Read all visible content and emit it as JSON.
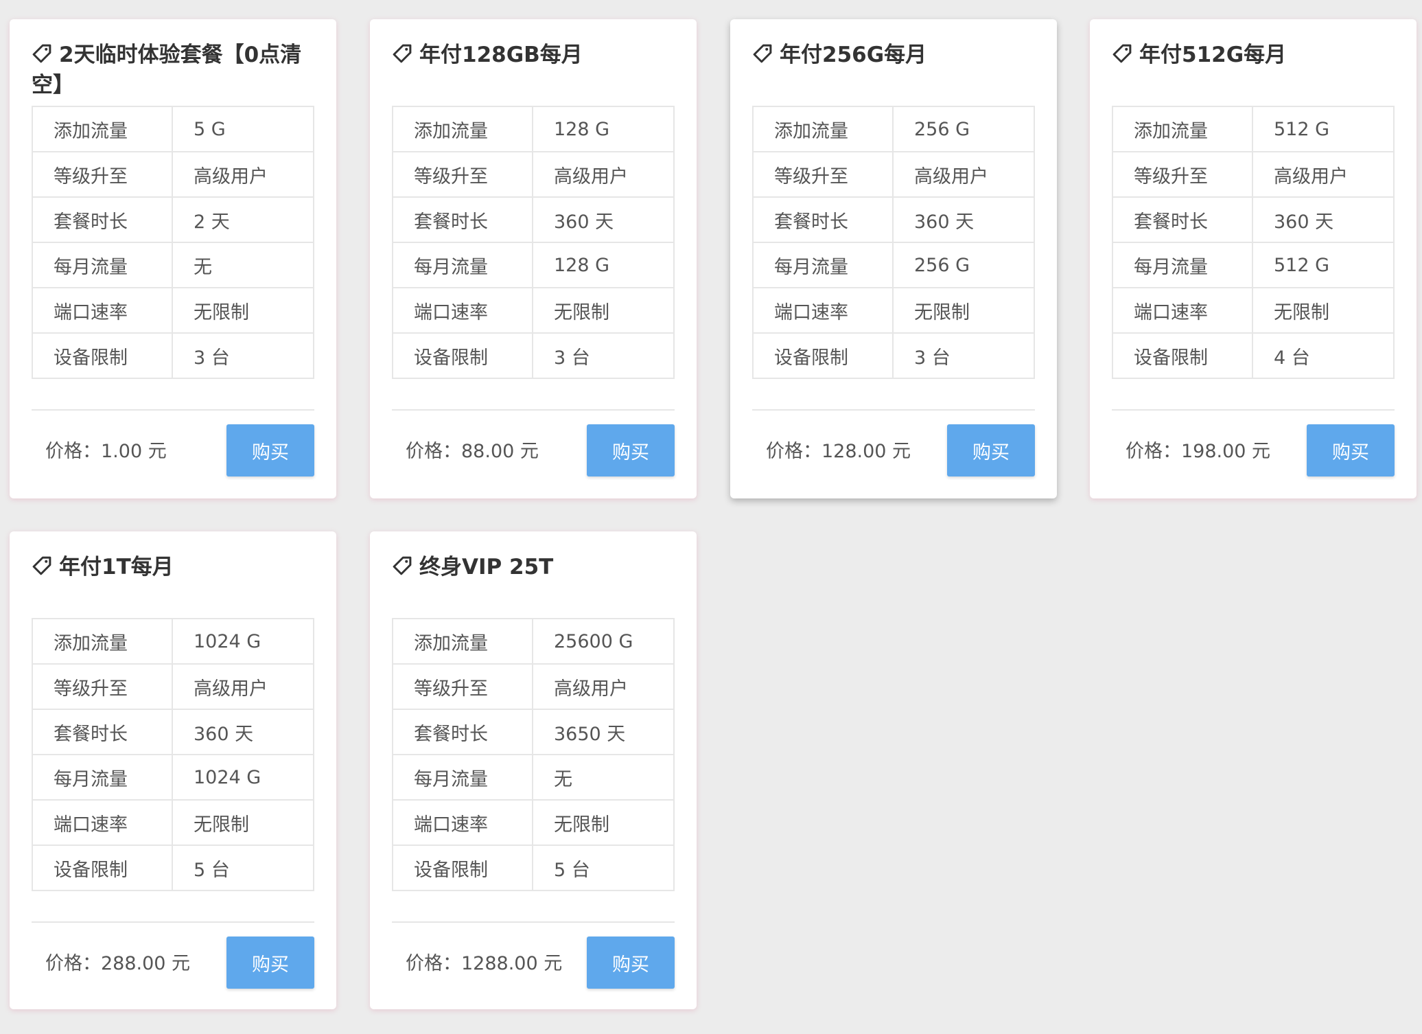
{
  "plans": [
    {
      "title": "2天临时体验套餐【0点清空】",
      "specs": [
        {
          "label": "添加流量",
          "value": "5 G"
        },
        {
          "label": "等级升至",
          "value": "高级用户"
        },
        {
          "label": "套餐时长",
          "value": "2 天"
        },
        {
          "label": "每月流量",
          "value": "无"
        },
        {
          "label": "端口速率",
          "value": "无限制"
        },
        {
          "label": "设备限制",
          "value": "3 台"
        }
      ],
      "price": "价格：1.00 元",
      "buy_label": "购买"
    },
    {
      "title": "年付128GB每月",
      "specs": [
        {
          "label": "添加流量",
          "value": "128 G"
        },
        {
          "label": "等级升至",
          "value": "高级用户"
        },
        {
          "label": "套餐时长",
          "value": "360 天"
        },
        {
          "label": "每月流量",
          "value": "128 G"
        },
        {
          "label": "端口速率",
          "value": "无限制"
        },
        {
          "label": "设备限制",
          "value": "3 台"
        }
      ],
      "price": "价格：88.00 元",
      "buy_label": "购买"
    },
    {
      "title": "年付256G每月",
      "specs": [
        {
          "label": "添加流量",
          "value": "256 G"
        },
        {
          "label": "等级升至",
          "value": "高级用户"
        },
        {
          "label": "套餐时长",
          "value": "360 天"
        },
        {
          "label": "每月流量",
          "value": "256 G"
        },
        {
          "label": "端口速率",
          "value": "无限制"
        },
        {
          "label": "设备限制",
          "value": "3 台"
        }
      ],
      "price": "价格：128.00 元",
      "buy_label": "购买"
    },
    {
      "title": "年付512G每月",
      "specs": [
        {
          "label": "添加流量",
          "value": "512 G"
        },
        {
          "label": "等级升至",
          "value": "高级用户"
        },
        {
          "label": "套餐时长",
          "value": "360 天"
        },
        {
          "label": "每月流量",
          "value": "512 G"
        },
        {
          "label": "端口速率",
          "value": "无限制"
        },
        {
          "label": "设备限制",
          "value": "4 台"
        }
      ],
      "price": "价格：198.00 元",
      "buy_label": "购买"
    },
    {
      "title": "年付1T每月",
      "specs": [
        {
          "label": "添加流量",
          "value": "1024 G"
        },
        {
          "label": "等级升至",
          "value": "高级用户"
        },
        {
          "label": "套餐时长",
          "value": "360 天"
        },
        {
          "label": "每月流量",
          "value": "1024 G"
        },
        {
          "label": "端口速率",
          "value": "无限制"
        },
        {
          "label": "设备限制",
          "value": "5 台"
        }
      ],
      "price": "价格：288.00 元",
      "buy_label": "购买"
    },
    {
      "title": "终身VIP 25T",
      "specs": [
        {
          "label": "添加流量",
          "value": "25600 G"
        },
        {
          "label": "等级升至",
          "value": "高级用户"
        },
        {
          "label": "套餐时长",
          "value": "3650 天"
        },
        {
          "label": "每月流量",
          "value": "无"
        },
        {
          "label": "端口速率",
          "value": "无限制"
        },
        {
          "label": "设备限制",
          "value": "5 台"
        }
      ],
      "price": "价格：1288.00 元",
      "buy_label": "购买"
    }
  ],
  "icons": {
    "title_icon": "tag-icon"
  },
  "colors": {
    "page_background": "#ececec",
    "buy_button": "#5fa8ec"
  }
}
